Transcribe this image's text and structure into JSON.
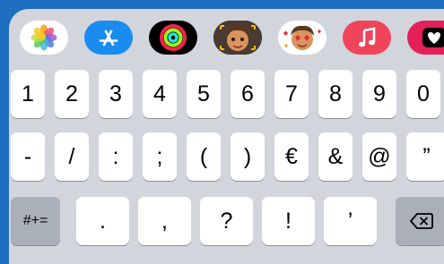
{
  "app_bar": {
    "apps": [
      {
        "name": "Photos",
        "icon": "photos-icon"
      },
      {
        "name": "App Store",
        "icon": "app-store-icon"
      },
      {
        "name": "Activity",
        "icon": "activity-rings-icon"
      },
      {
        "name": "Memoji",
        "icon": "memoji-icon"
      },
      {
        "name": "Memoji Stickers",
        "icon": "memoji-stickers-icon"
      },
      {
        "name": "Music",
        "icon": "music-icon"
      },
      {
        "name": "Digital Touch",
        "icon": "digital-touch-icon"
      }
    ]
  },
  "keys": {
    "row1": [
      "1",
      "2",
      "3",
      "4",
      "5",
      "6",
      "7",
      "8",
      "9",
      "0"
    ],
    "row2": [
      "-",
      "/",
      ":",
      ";",
      "(",
      ")",
      "€",
      "&",
      "@",
      "”"
    ],
    "row3": {
      "toggle": "#+=",
      "keys": [
        ".",
        ",",
        "?",
        "!",
        "’"
      ],
      "delete_icon": "delete-backspace-icon"
    }
  },
  "colors": {
    "background": "#1f6fc0",
    "keyboard": "#d2d5dc",
    "key": "#ffffff",
    "key_dark": "#aab0ba",
    "music_red": "#f0445b",
    "app_store_blue": "#1a8cf0"
  }
}
